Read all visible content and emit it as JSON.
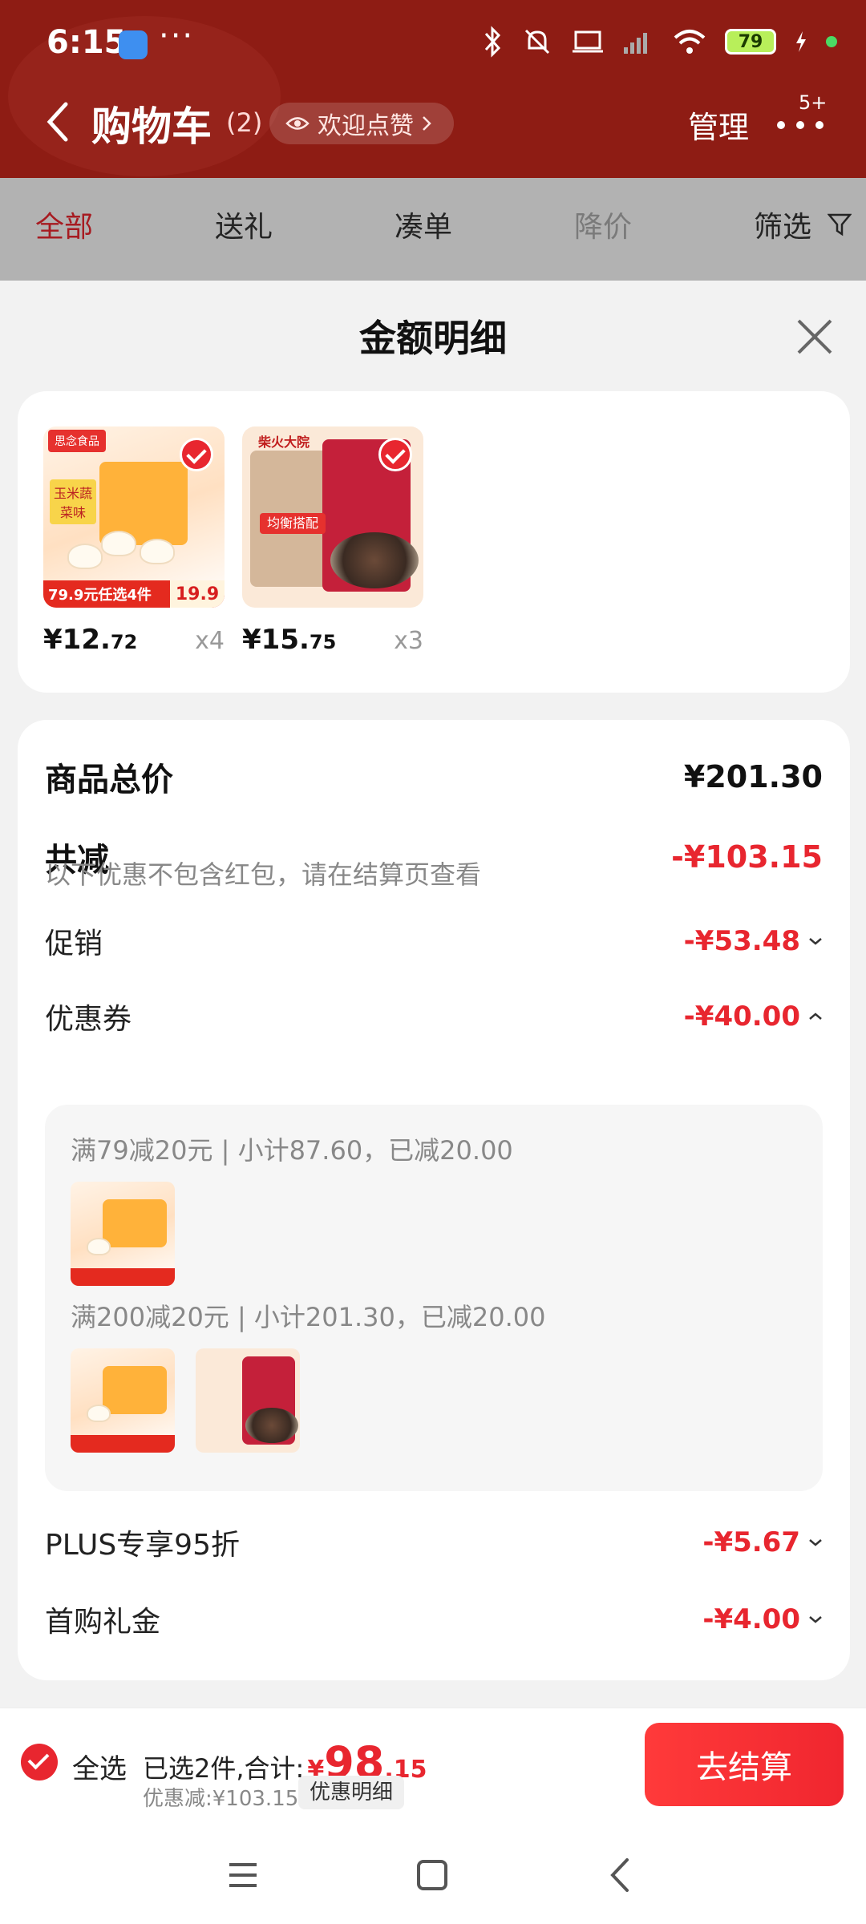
{
  "status_bar": {
    "time": "6:15",
    "more": "···",
    "battery": "79"
  },
  "nav": {
    "title": "购物车",
    "count": "(2)",
    "like_label": "欢迎点赞",
    "manage": "管理",
    "more_badge": "5+"
  },
  "tabs": [
    "全部",
    "送礼",
    "凑单",
    "降价",
    "筛选"
  ],
  "sheet": {
    "title": "金额明细"
  },
  "products": [
    {
      "price_int": "¥12.",
      "price_dec": "72",
      "qty": "x4",
      "image": {
        "brand": "思念食品",
        "label": "玉米蔬菜味",
        "promo": "79.9元任选4件",
        "promo_price": "19.9"
      }
    },
    {
      "price_int": "¥15.",
      "price_dec": "75",
      "qty": "x3",
      "image": {
        "brand": "柴火大院",
        "label": "均衡搭配"
      }
    }
  ],
  "summary": {
    "total_label": "商品总价",
    "total_value": "¥201.30",
    "reduce_label": "共减",
    "reduce_value": "-¥103.15",
    "note": "以下优惠不包含红包，请在结算页查看",
    "promo_label": "促销",
    "promo_value": "-¥53.48",
    "coupon_label": "优惠券",
    "coupon_value": "-¥40.00",
    "coupons": [
      {
        "text": "满79减20元 | 小计87.60，已减20.00"
      },
      {
        "text": "满200减20元 | 小计201.30，已减20.00"
      }
    ],
    "plus_label": "PLUS专享95折",
    "plus_value": "-¥5.67",
    "first_label": "首购礼金",
    "first_value": "-¥4.00"
  },
  "bottom": {
    "select_all": "全选",
    "summary_prefix": "已选2件,合计:",
    "yen": "¥",
    "total_int": "98",
    "total_dec": ".15",
    "discount": "优惠减:¥103.15",
    "detail_button": "优惠明细",
    "checkout": "去结算"
  },
  "colors": {
    "brand_red": "#e8262f",
    "header_bg": "#8e1c14"
  }
}
